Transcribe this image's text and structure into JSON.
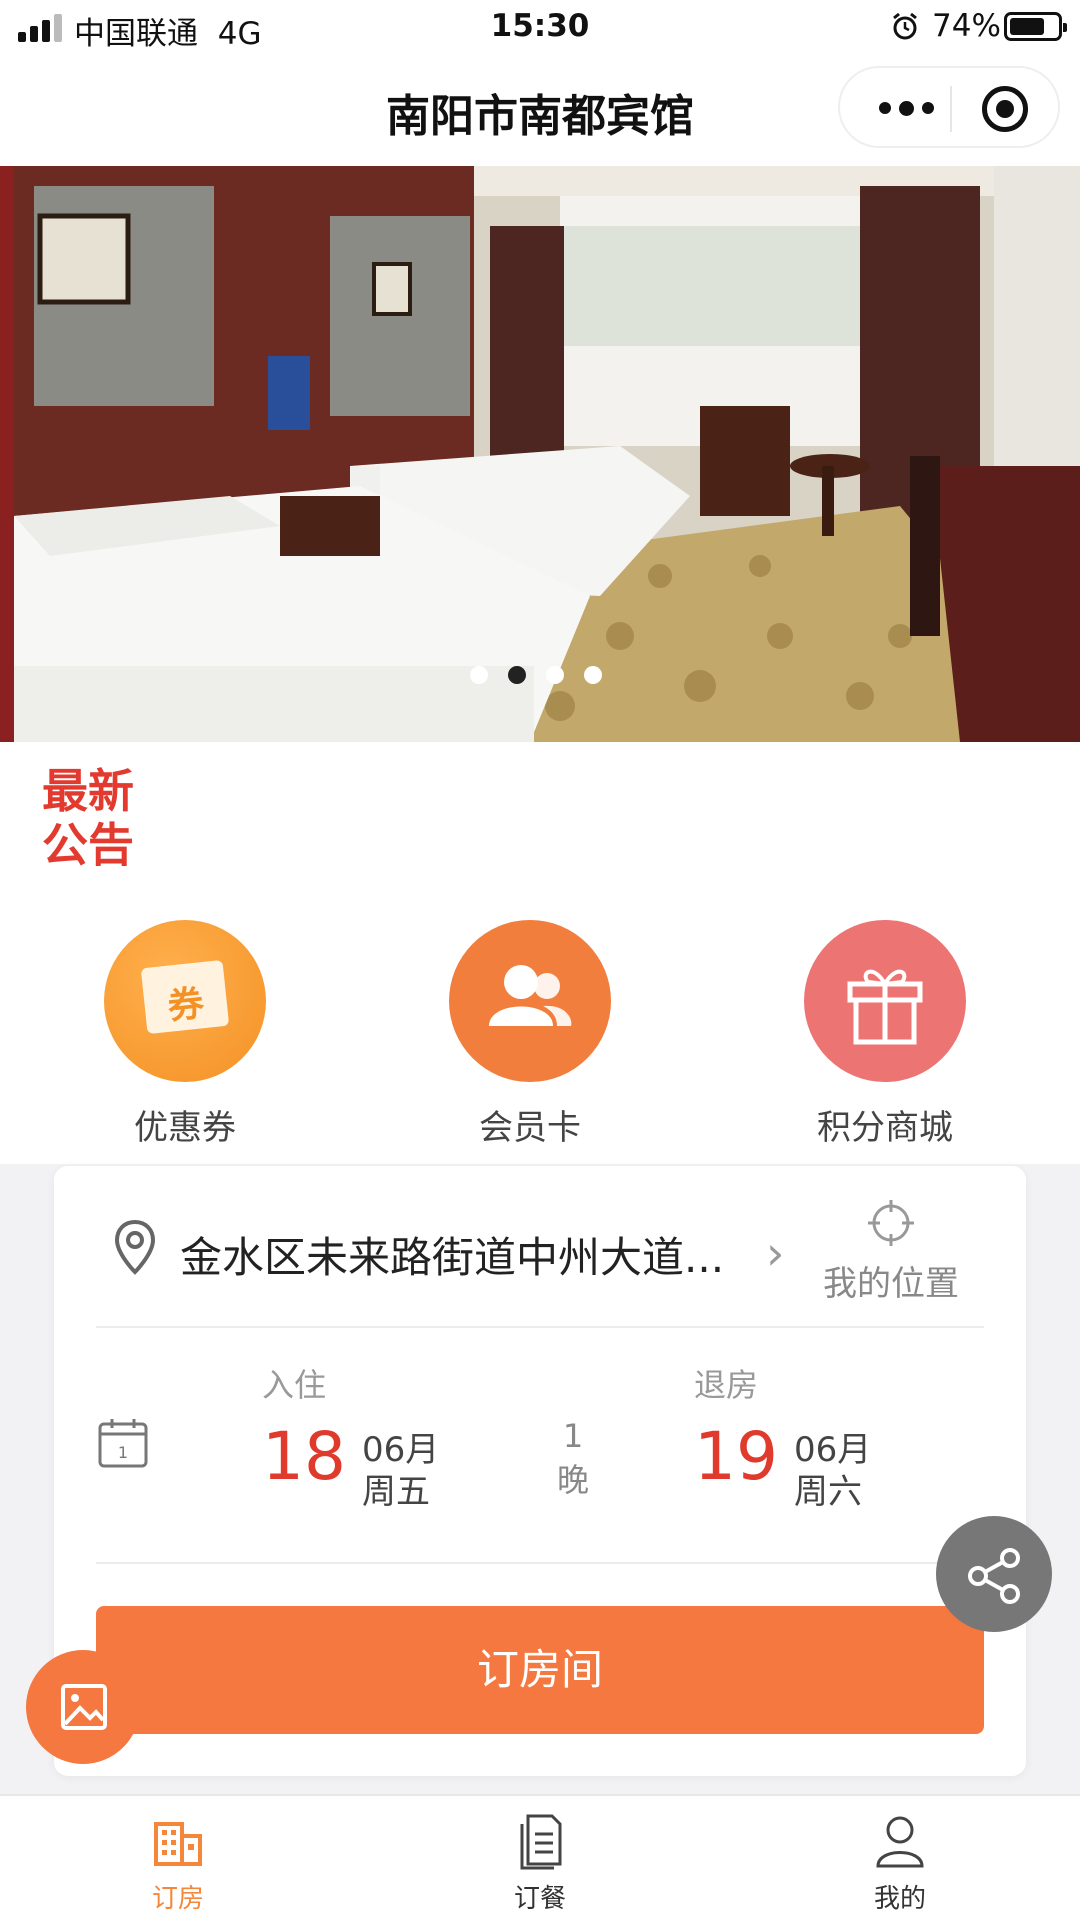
{
  "status_bar": {
    "carrier": "中国联通",
    "network": "4G",
    "time": "15:30",
    "battery_percent_text": "74%",
    "battery_level": 0.74,
    "signal_bars_active": 3,
    "signal_bars_total": 4
  },
  "nav": {
    "title": "南阳市南都宾馆"
  },
  "banner": {
    "slide_count": 4,
    "active_slide": 1
  },
  "notice": {
    "line1": "最新",
    "line2": "公告"
  },
  "quick_actions": [
    {
      "label": "优惠券",
      "icon": "coupon-icon",
      "icon_text": "券",
      "color": "#f49125"
    },
    {
      "label": "会员卡",
      "icon": "members-icon",
      "color": "#f27e3d"
    },
    {
      "label": "积分商城",
      "icon": "gift-icon",
      "color": "#ec7473"
    }
  ],
  "booking": {
    "address": "金水区未来路街道中州大道...",
    "my_location_label": "我的位置",
    "checkin": {
      "caption": "入住",
      "day": "18",
      "month": "06月",
      "weekday": "周五"
    },
    "nights": {
      "count": "1",
      "unit": "晚"
    },
    "checkout": {
      "caption": "退房",
      "day": "19",
      "month": "06月",
      "weekday": "周六"
    },
    "calendar_icon_text": "1",
    "book_button": "订房间"
  },
  "tabs": [
    {
      "label": "订房",
      "icon": "building-icon",
      "active": true
    },
    {
      "label": "订餐",
      "icon": "document-icon",
      "active": false
    },
    {
      "label": "我的",
      "icon": "user-icon",
      "active": false
    }
  ],
  "colors": {
    "accent": "#f47840",
    "date_red": "#e03a2c",
    "notice_red": "#e23a2e",
    "tab_active": "#f4873a"
  }
}
